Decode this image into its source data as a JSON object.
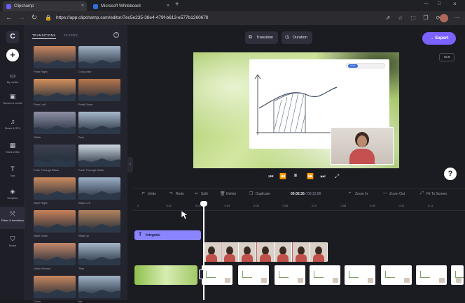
{
  "browser": {
    "tabs": [
      {
        "label": "Clipchamp",
        "fav_color": "#6b5cff"
      },
      {
        "label": "Microsoft Whiteboard",
        "fav_color": "#2f6fde"
      }
    ],
    "url": "https://app.clipchamp.com/editor/7ec5e235-38e4-479f-b613-e577b1260678"
  },
  "rail": {
    "items": [
      {
        "label": "My media",
        "icon": "folder-icon"
      },
      {
        "label": "Record & create",
        "icon": "camera-icon"
      },
      {
        "label": "Music & SFX",
        "icon": "music-icon"
      },
      {
        "label": "Stock video",
        "icon": "film-icon"
      },
      {
        "label": "Text",
        "icon": "text-icon"
      },
      {
        "label": "Graphics",
        "icon": "shapes-icon"
      },
      {
        "label": "Filters & transitions",
        "icon": "transitions-icon"
      },
      {
        "label": "Brand",
        "icon": "shield-icon"
      }
    ]
  },
  "panel": {
    "tabs": [
      "TRANSITIONS",
      "FILTERS"
    ],
    "transitions": [
      {
        "label": "Push Right",
        "sky": "#c7855e"
      },
      {
        "label": "Cross blur",
        "sky": "#9fb0c4"
      },
      {
        "label": "Push Left",
        "sky": "#d38f5c"
      },
      {
        "label": "Push Down",
        "sky": "#b8774e"
      },
      {
        "label": "Glitch",
        "sky": "#8e8fa4"
      },
      {
        "label": "Spin",
        "sky": "#a7b9cc"
      },
      {
        "label": "Fade Through Black",
        "sky": "#3d4250"
      },
      {
        "label": "Fade Through White",
        "sky": "#cdd6e0"
      },
      {
        "label": "Wipe Right",
        "sky": "#cc8a5e"
      },
      {
        "label": "Wipe Left",
        "sky": "#9cb0c7"
      },
      {
        "label": "Wipe Down",
        "sky": "#c9825a"
      },
      {
        "label": "Wipe Up",
        "sky": "#b3835e"
      },
      {
        "label": "Glitch Reveal",
        "sky": "#c4876a"
      },
      {
        "label": "Tiles",
        "sky": "#a5b7c9"
      },
      {
        "label": "Close",
        "sky": "#c8875d"
      },
      {
        "label": "Iris",
        "sky": "#9fb2c6"
      }
    ]
  },
  "toolbar": {
    "transition": "Transition",
    "duration": "Duration",
    "export": "Export",
    "ratio": "16:9"
  },
  "preview": {
    "board_toolbar": "Draw"
  },
  "timeline": {
    "undo": "Undo",
    "redo": "Redo",
    "split": "Split",
    "delete": "Delete",
    "duplicate": "Duplicate",
    "time_current": "00:02.35",
    "time_total": "00:12.80",
    "zoom_in": "Zoom In",
    "zoom_out": "Zoom Out",
    "fit": "Fit To Screen",
    "ticks": [
      "0",
      "0:02",
      "0:03",
      "0:04",
      "0:05",
      "0:06",
      "0:07",
      "0:08",
      "0:09",
      "0:10",
      "0:11"
    ],
    "text_clip": "Integrals"
  }
}
